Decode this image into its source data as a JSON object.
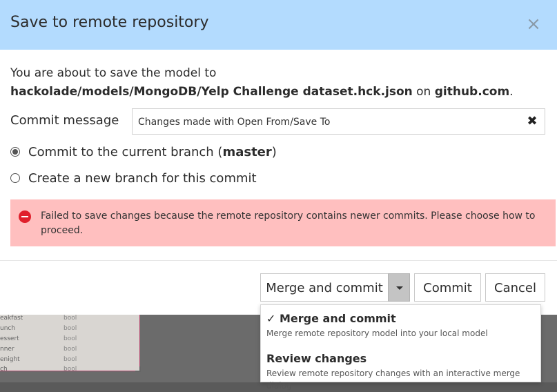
{
  "dialog": {
    "title": "Save to remote repository",
    "close_label": "×",
    "intro_line1": "You are about to save the model to",
    "model_path": "hackolade/models/MongoDB/Yelp Challenge dataset.hck.json",
    "intro_on": " on ",
    "host": "github.com",
    "intro_end": "."
  },
  "commit": {
    "label": "Commit message",
    "value": "Changes made with Open From/Save To",
    "clear_label": "✖"
  },
  "branch_options": {
    "current_prefix": "Commit to the current branch (",
    "current_branch": "master",
    "current_suffix": ")",
    "new_branch": "Create a new branch for this commit",
    "selected": "current"
  },
  "error": {
    "message": "Failed to save changes because the remote repository contains newer commits. Please choose how to proceed."
  },
  "buttons": {
    "merge": "Merge and commit",
    "commit": "Commit",
    "cancel": "Cancel"
  },
  "dropdown": {
    "items": [
      {
        "title": "✓ Merge and commit",
        "description": "Merge remote repository model into your local model"
      },
      {
        "title": "Review changes",
        "description": "Review remote repository changes with an interactive merge dialog"
      }
    ]
  },
  "background": {
    "rows": [
      {
        "field": "eakfast",
        "type": "bool"
      },
      {
        "field": "unch",
        "type": "bool"
      },
      {
        "field": "essert",
        "type": "bool"
      },
      {
        "field": "nner",
        "type": "bool"
      },
      {
        "field": "enight",
        "type": "bool"
      },
      {
        "field": "ch",
        "type": "bool"
      }
    ]
  },
  "colors": {
    "header": "#b3dbfe",
    "error_bg": "#ffbfbf",
    "error_icon": "#e0202c"
  }
}
